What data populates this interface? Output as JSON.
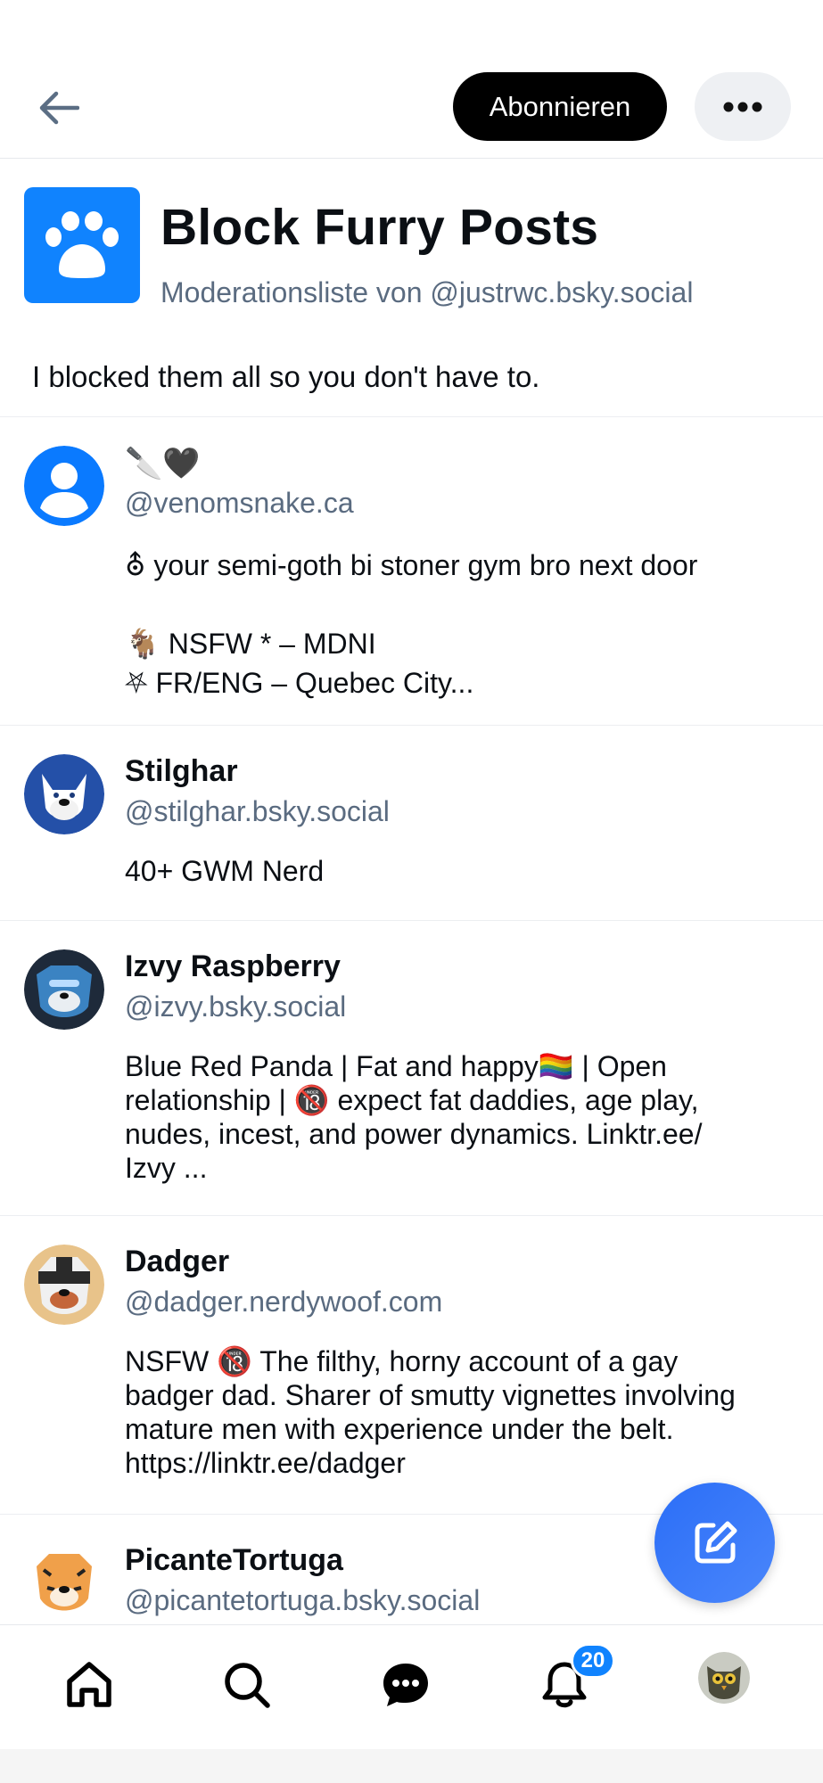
{
  "header": {
    "subscribe_label": "Abonnieren",
    "back_icon": "arrow-left-icon",
    "more_icon": "ellipsis-icon"
  },
  "list": {
    "title": "Block Furry Posts",
    "subtitle": "Moderationsliste von @justrwc.bsky.social",
    "description": "I blocked them all so you don't have to.",
    "avatar_icon": "people-icon",
    "avatar_color": "#1083fe"
  },
  "members": [
    {
      "name": "🔪🖤",
      "handle": "@venomsnake.ca",
      "bio_lines": [
        " ⛢ your semi-goth bi stoner gym bro next door",
        "",
        "🐐 NSFW * – MDNI",
        " ⛧  FR/ENG – Quebec City..."
      ]
    },
    {
      "name": "Stilghar",
      "handle": "@stilghar.bsky.social",
      "bio_lines": [
        "40+ GWM Nerd"
      ]
    },
    {
      "name": "Izvy Raspberry",
      "handle": "@izvy.bsky.social",
      "bio_lines": [
        "Blue Red Panda | Fat and happy🏳️‍🌈 | Open",
        "relationship | 🔞 expect fat daddies, age play,",
        "nudes, incest, and power dynamics. Linktr.ee/",
        "Izvy ..."
      ]
    },
    {
      "name": "Dadger",
      "handle": "@dadger.nerdywoof.com",
      "bio_lines": [
        "NSFW 🔞 The filthy, horny account of a gay",
        "badger dad. Sharer of smutty vignettes involving",
        "mature men with experience under the belt.",
        "https://linktr.ee/dadger"
      ]
    },
    {
      "name": "PicanteTortuga",
      "handle": "@picantetortuga.bsky.social",
      "bio_lines": []
    }
  ],
  "nav": {
    "notification_count": "20",
    "accent_color": "#1083fe"
  }
}
